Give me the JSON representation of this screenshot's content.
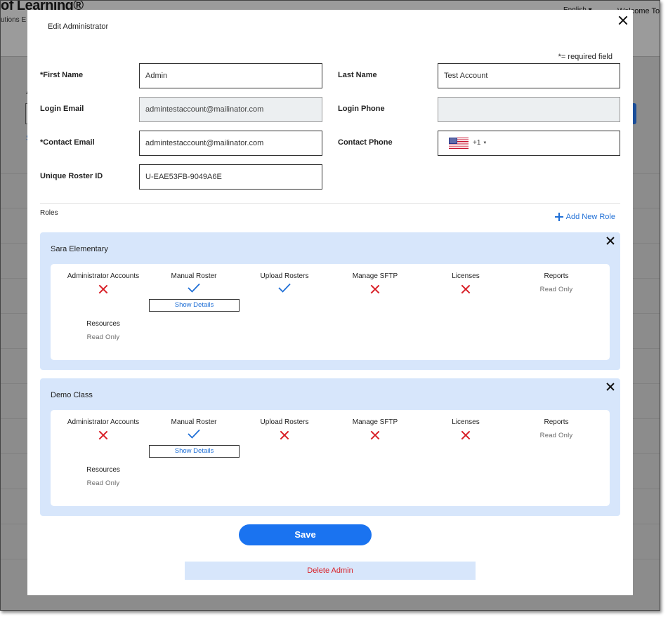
{
  "background": {
    "logo": "of Learning®",
    "logo_sub": "utions E",
    "language": "English ▾",
    "welcome": "Welcome To"
  },
  "modal": {
    "title": "Edit Administrator",
    "required_note": "*= required field",
    "fields": {
      "first_name": {
        "label": "*First Name",
        "value": "Admin"
      },
      "last_name": {
        "label": "Last Name",
        "value": "Test Account"
      },
      "login_email": {
        "label": "Login Email",
        "value": "admintestaccount@mailinator.com"
      },
      "login_phone": {
        "label": "Login Phone",
        "value": ""
      },
      "contact_email": {
        "label": "*Contact Email",
        "value": "admintestaccount@mailinator.com"
      },
      "contact_phone": {
        "label": "Contact Phone",
        "dial_code": "+1",
        "value": ""
      },
      "roster_id": {
        "label": "Unique Roster ID",
        "value": "U-EAE53FB-9049A6E"
      }
    },
    "roles_label": "Roles",
    "add_role_label": "Add New Role",
    "show_details_label": "Show Details",
    "roles": [
      {
        "name": "Sara Elementary",
        "permissions": [
          {
            "label": "Administrator Accounts",
            "status": "denied"
          },
          {
            "label": "Manual Roster",
            "status": "granted",
            "details": true
          },
          {
            "label": "Upload Rosters",
            "status": "granted"
          },
          {
            "label": "Manage SFTP",
            "status": "denied"
          },
          {
            "label": "Licenses",
            "status": "denied"
          },
          {
            "label": "Reports",
            "status": "text",
            "text": "Read Only"
          },
          {
            "label": "Resources",
            "status": "text",
            "text": "Read Only"
          }
        ]
      },
      {
        "name": "Demo Class",
        "permissions": [
          {
            "label": "Administrator Accounts",
            "status": "denied"
          },
          {
            "label": "Manual Roster",
            "status": "granted",
            "details": true
          },
          {
            "label": "Upload Rosters",
            "status": "denied"
          },
          {
            "label": "Manage SFTP",
            "status": "denied"
          },
          {
            "label": "Licenses",
            "status": "denied"
          },
          {
            "label": "Reports",
            "status": "text",
            "text": "Read Only"
          },
          {
            "label": "Resources",
            "status": "text",
            "text": "Read Only"
          }
        ]
      }
    ],
    "save_label": "Save",
    "delete_label": "Delete Admin",
    "colors": {
      "accent": "#1a73f0",
      "denied": "#d81f27",
      "role_bg": "#d7e6fb"
    },
    "icons": {
      "granted": "check-icon",
      "denied": "x-icon",
      "close": "close-icon",
      "add": "plus-icon",
      "flag": "us-flag-icon"
    }
  }
}
